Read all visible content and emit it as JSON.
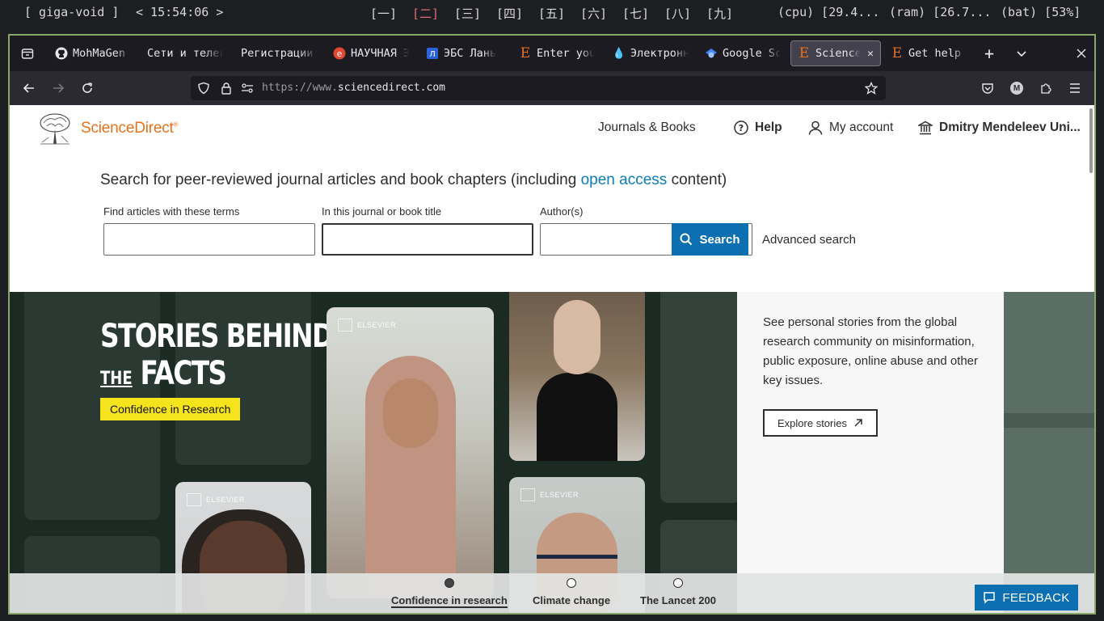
{
  "statusbar": {
    "session": "[ giga-void ]",
    "clock": "< 15:54:06 >",
    "workspaces": [
      "[一]",
      "[二]",
      "[三]",
      "[四]",
      "[五]",
      "[六]",
      "[七]",
      "[八]",
      "[九]"
    ],
    "active_workspace_index": 1,
    "cpu": "(cpu) [29.4...",
    "ram": "(ram) [26.7...",
    "bat": "(bat) [53%]"
  },
  "browser": {
    "tabs": [
      {
        "title": "MohMaGen (",
        "icon": "github-icon"
      },
      {
        "title": "Сети и телекс",
        "icon": "blank-icon"
      },
      {
        "title": "Регистрации /",
        "icon": "blank-icon"
      },
      {
        "title": "НАУЧНАЯ ЭЛ",
        "icon": "elibrary-icon"
      },
      {
        "title": "ЭБС Лань",
        "icon": "lan-icon"
      },
      {
        "title": "Enter your",
        "icon": "elsevier-icon"
      },
      {
        "title": "Электронна",
        "icon": "drop-icon"
      },
      {
        "title": "Google Sch",
        "icon": "scholar-icon"
      },
      {
        "title": "ScienceD",
        "icon": "elsevier-icon",
        "active": true
      },
      {
        "title": "Get help w",
        "icon": "elsevier-icon"
      }
    ],
    "url_prefix": "https://www.",
    "url_domain": "sciencedirect.com",
    "profile_initial": "M"
  },
  "header": {
    "brand": "ScienceDirect",
    "brand_mark": "®",
    "nav": {
      "journals": "Journals & Books",
      "help": "Help",
      "account": "My account",
      "institution": "Dmitry Mendeleev Uni..."
    }
  },
  "search": {
    "heading_before": "Search for peer-reviewed journal articles and book chapters (including ",
    "heading_link": "open access",
    "heading_after": " content)",
    "field_terms_label": "Find articles with these terms",
    "field_journal_label": "In this journal or book title",
    "field_author_label": "Author(s)",
    "field_terms_value": "",
    "field_journal_value": "",
    "field_author_value": "",
    "button": "Search",
    "advanced": "Advanced search"
  },
  "hero": {
    "title_line1": "STORIES BEHIND",
    "title_the": "THE",
    "title_line2": "FACTS",
    "badge": "Confidence in Research",
    "photo_brand": "ELSEVIER",
    "description": "See personal stories from the global research community on misinformation, public exposure, online abuse and other key issues.",
    "explore": "Explore stories"
  },
  "carousel": {
    "items": [
      "Confidence in research",
      "Climate change",
      "The Lancet 200"
    ],
    "active_index": 0
  },
  "feedback": "FEEDBACK",
  "colors": {
    "brand_orange": "#e9711c",
    "link_blue": "#0c7dbb",
    "button_blue": "#0c6fb2",
    "badge_yellow": "#f5e41c",
    "hero_dark": "#1c2a24"
  }
}
